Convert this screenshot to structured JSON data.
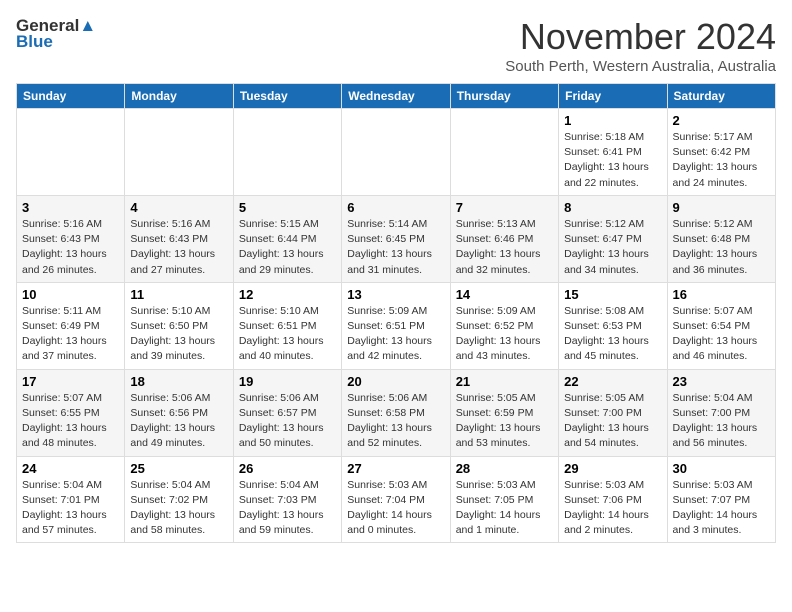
{
  "logo": {
    "line1": "General",
    "line2": "Blue"
  },
  "title": "November 2024",
  "subtitle": "South Perth, Western Australia, Australia",
  "days_of_week": [
    "Sunday",
    "Monday",
    "Tuesday",
    "Wednesday",
    "Thursday",
    "Friday",
    "Saturday"
  ],
  "weeks": [
    [
      {
        "day": "",
        "info": ""
      },
      {
        "day": "",
        "info": ""
      },
      {
        "day": "",
        "info": ""
      },
      {
        "day": "",
        "info": ""
      },
      {
        "day": "",
        "info": ""
      },
      {
        "day": "1",
        "info": "Sunrise: 5:18 AM\nSunset: 6:41 PM\nDaylight: 13 hours\nand 22 minutes."
      },
      {
        "day": "2",
        "info": "Sunrise: 5:17 AM\nSunset: 6:42 PM\nDaylight: 13 hours\nand 24 minutes."
      }
    ],
    [
      {
        "day": "3",
        "info": "Sunrise: 5:16 AM\nSunset: 6:43 PM\nDaylight: 13 hours\nand 26 minutes."
      },
      {
        "day": "4",
        "info": "Sunrise: 5:16 AM\nSunset: 6:43 PM\nDaylight: 13 hours\nand 27 minutes."
      },
      {
        "day": "5",
        "info": "Sunrise: 5:15 AM\nSunset: 6:44 PM\nDaylight: 13 hours\nand 29 minutes."
      },
      {
        "day": "6",
        "info": "Sunrise: 5:14 AM\nSunset: 6:45 PM\nDaylight: 13 hours\nand 31 minutes."
      },
      {
        "day": "7",
        "info": "Sunrise: 5:13 AM\nSunset: 6:46 PM\nDaylight: 13 hours\nand 32 minutes."
      },
      {
        "day": "8",
        "info": "Sunrise: 5:12 AM\nSunset: 6:47 PM\nDaylight: 13 hours\nand 34 minutes."
      },
      {
        "day": "9",
        "info": "Sunrise: 5:12 AM\nSunset: 6:48 PM\nDaylight: 13 hours\nand 36 minutes."
      }
    ],
    [
      {
        "day": "10",
        "info": "Sunrise: 5:11 AM\nSunset: 6:49 PM\nDaylight: 13 hours\nand 37 minutes."
      },
      {
        "day": "11",
        "info": "Sunrise: 5:10 AM\nSunset: 6:50 PM\nDaylight: 13 hours\nand 39 minutes."
      },
      {
        "day": "12",
        "info": "Sunrise: 5:10 AM\nSunset: 6:51 PM\nDaylight: 13 hours\nand 40 minutes."
      },
      {
        "day": "13",
        "info": "Sunrise: 5:09 AM\nSunset: 6:51 PM\nDaylight: 13 hours\nand 42 minutes."
      },
      {
        "day": "14",
        "info": "Sunrise: 5:09 AM\nSunset: 6:52 PM\nDaylight: 13 hours\nand 43 minutes."
      },
      {
        "day": "15",
        "info": "Sunrise: 5:08 AM\nSunset: 6:53 PM\nDaylight: 13 hours\nand 45 minutes."
      },
      {
        "day": "16",
        "info": "Sunrise: 5:07 AM\nSunset: 6:54 PM\nDaylight: 13 hours\nand 46 minutes."
      }
    ],
    [
      {
        "day": "17",
        "info": "Sunrise: 5:07 AM\nSunset: 6:55 PM\nDaylight: 13 hours\nand 48 minutes."
      },
      {
        "day": "18",
        "info": "Sunrise: 5:06 AM\nSunset: 6:56 PM\nDaylight: 13 hours\nand 49 minutes."
      },
      {
        "day": "19",
        "info": "Sunrise: 5:06 AM\nSunset: 6:57 PM\nDaylight: 13 hours\nand 50 minutes."
      },
      {
        "day": "20",
        "info": "Sunrise: 5:06 AM\nSunset: 6:58 PM\nDaylight: 13 hours\nand 52 minutes."
      },
      {
        "day": "21",
        "info": "Sunrise: 5:05 AM\nSunset: 6:59 PM\nDaylight: 13 hours\nand 53 minutes."
      },
      {
        "day": "22",
        "info": "Sunrise: 5:05 AM\nSunset: 7:00 PM\nDaylight: 13 hours\nand 54 minutes."
      },
      {
        "day": "23",
        "info": "Sunrise: 5:04 AM\nSunset: 7:00 PM\nDaylight: 13 hours\nand 56 minutes."
      }
    ],
    [
      {
        "day": "24",
        "info": "Sunrise: 5:04 AM\nSunset: 7:01 PM\nDaylight: 13 hours\nand 57 minutes."
      },
      {
        "day": "25",
        "info": "Sunrise: 5:04 AM\nSunset: 7:02 PM\nDaylight: 13 hours\nand 58 minutes."
      },
      {
        "day": "26",
        "info": "Sunrise: 5:04 AM\nSunset: 7:03 PM\nDaylight: 13 hours\nand 59 minutes."
      },
      {
        "day": "27",
        "info": "Sunrise: 5:03 AM\nSunset: 7:04 PM\nDaylight: 14 hours\nand 0 minutes."
      },
      {
        "day": "28",
        "info": "Sunrise: 5:03 AM\nSunset: 7:05 PM\nDaylight: 14 hours\nand 1 minute."
      },
      {
        "day": "29",
        "info": "Sunrise: 5:03 AM\nSunset: 7:06 PM\nDaylight: 14 hours\nand 2 minutes."
      },
      {
        "day": "30",
        "info": "Sunrise: 5:03 AM\nSunset: 7:07 PM\nDaylight: 14 hours\nand 3 minutes."
      }
    ]
  ]
}
